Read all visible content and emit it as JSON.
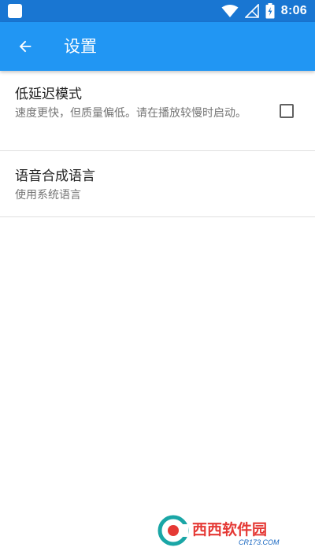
{
  "status_bar": {
    "time": "8:06",
    "icons": [
      "app-icon",
      "wifi-icon",
      "signal-icon",
      "battery-charging-icon"
    ]
  },
  "app_bar": {
    "back_icon": "arrow-left-icon",
    "title": "设置"
  },
  "settings": [
    {
      "title": "低延迟模式",
      "summary": "速度更快，但质量偏低。请在播放较慢时启动。",
      "checked": false
    },
    {
      "title": "语音合成语言",
      "summary": "使用系统语言"
    }
  ],
  "watermark": {
    "text": "西西软件园",
    "url_text": "CR173.COM",
    "colors": {
      "red": "#e53935",
      "teal": "#1aa6a6",
      "blue": "#1565c0"
    }
  },
  "colors": {
    "status_bar": "#1976d2",
    "app_bar": "#2196f3",
    "divider": "#e0e0e0",
    "title_text": "#212121",
    "summary_text": "#757575"
  }
}
